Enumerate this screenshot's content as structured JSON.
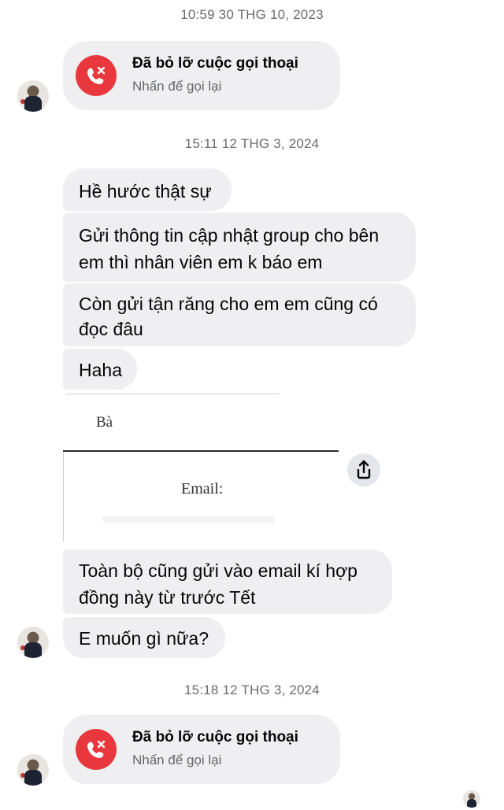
{
  "timestamps": {
    "t1": "10:59 30 THG 10, 2023",
    "t2": "15:11 12 THG 3, 2024",
    "t3": "15:18 12 THG 3, 2024"
  },
  "missed_call": {
    "title": "Đã bỏ lỡ cuộc gọi thoại",
    "subtitle": "Nhấn để gọi lại"
  },
  "messages": [
    "Hề hước thật sự",
    "Gửi thông tin cập nhật group cho bên em thì nhân viên em k báo em",
    "Còn gửi tận răng cho em em cũng có đọc đâu",
    "Haha",
    "Toàn bộ cũng gửi vào email kí hợp đồng này từ trước Tết",
    "E muốn gì nữa?"
  ],
  "message_lines": {
    "m2a": "Gửi thông tin cập nhật group cho bên",
    "m2b": "em thì nhân viên em k báo em",
    "m3a": "Còn gửi tận răng cho em em cũng có",
    "m3b": "đọc đâu",
    "m5a": "Toàn bộ cũng gửi vào email kí hợp",
    "m5b": "đồng này từ trước Tết"
  },
  "attachment": {
    "salutation": "Bà",
    "email_label": "Email:"
  },
  "icons": {
    "missed_call": "missed-call-icon",
    "share": "share-icon"
  },
  "colors": {
    "bubble": "#efeff1",
    "missed_call_red": "#e9383d",
    "timestamp": "#6b6b6b"
  }
}
